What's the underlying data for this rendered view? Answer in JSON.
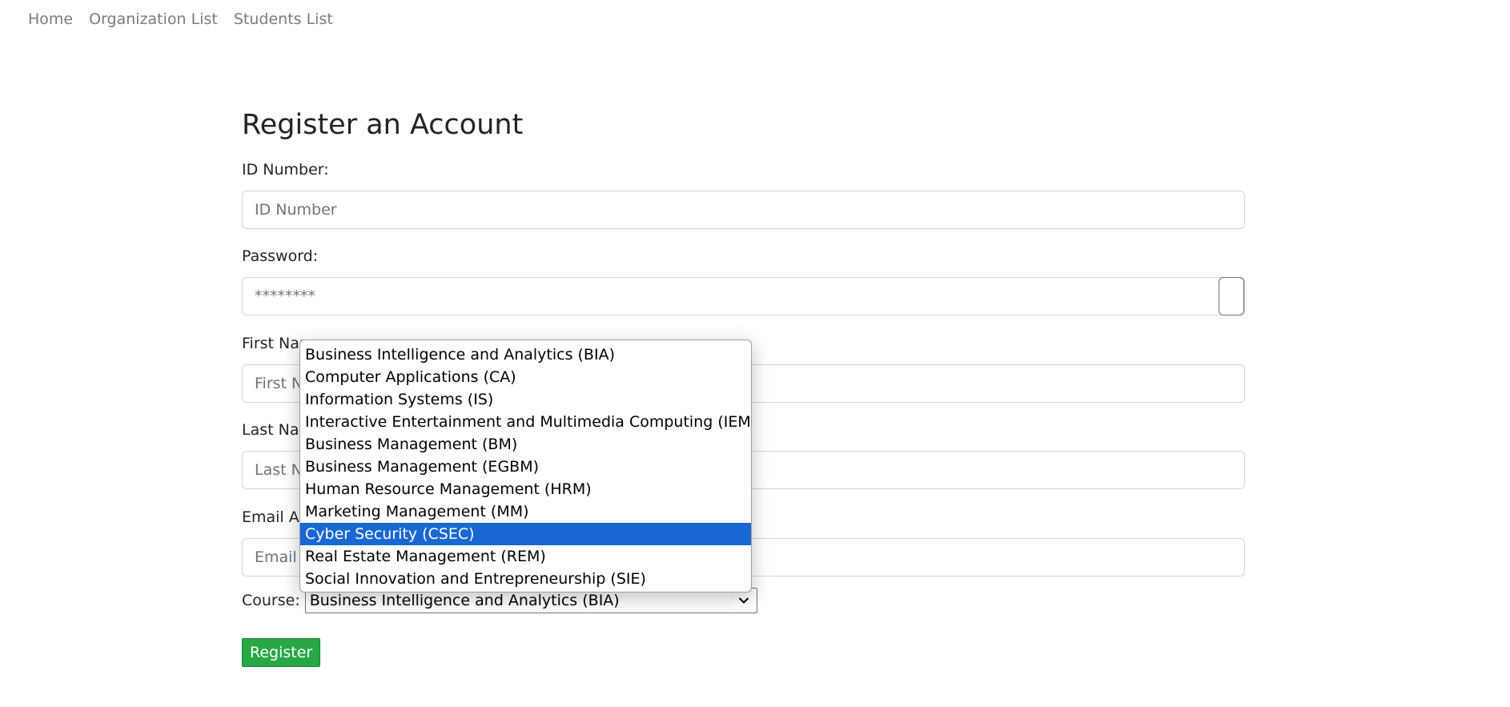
{
  "nav": {
    "items": [
      {
        "label": "Home"
      },
      {
        "label": "Organization List"
      },
      {
        "label": "Students List"
      }
    ]
  },
  "form": {
    "title": "Register an Account",
    "id_number": {
      "label": "ID Number:",
      "placeholder": "ID Number"
    },
    "password": {
      "label": "Password:",
      "value_masked": "********"
    },
    "first_name": {
      "label": "First Name:",
      "placeholder": "First Name"
    },
    "last_name": {
      "label": "Last Name:",
      "placeholder": "Last Name"
    },
    "email": {
      "label": "Email Address:",
      "placeholder": "Email Address"
    },
    "course": {
      "label": "Course:",
      "selected": "Business Intelligence and Analytics (BIA)",
      "highlighted": "Cyber Security (CSEC)",
      "options": [
        "Business Intelligence and Analytics (BIA)",
        "Computer Applications (CA)",
        "Information Systems (IS)",
        "Interactive Entertainment and Multimedia Computing (IEMC)",
        "Business Management (BM)",
        "Business Management (EGBM)",
        "Human Resource Management (HRM)",
        "Marketing Management (MM)",
        "Cyber Security (CSEC)",
        "Real Estate Management (REM)",
        "Social Innovation and Entrepreneurship (SIE)"
      ]
    },
    "submit_label": "Register"
  },
  "colors": {
    "highlight": "#1967d2",
    "register_button": "#28a745",
    "nav_link": "#7a7d80"
  }
}
